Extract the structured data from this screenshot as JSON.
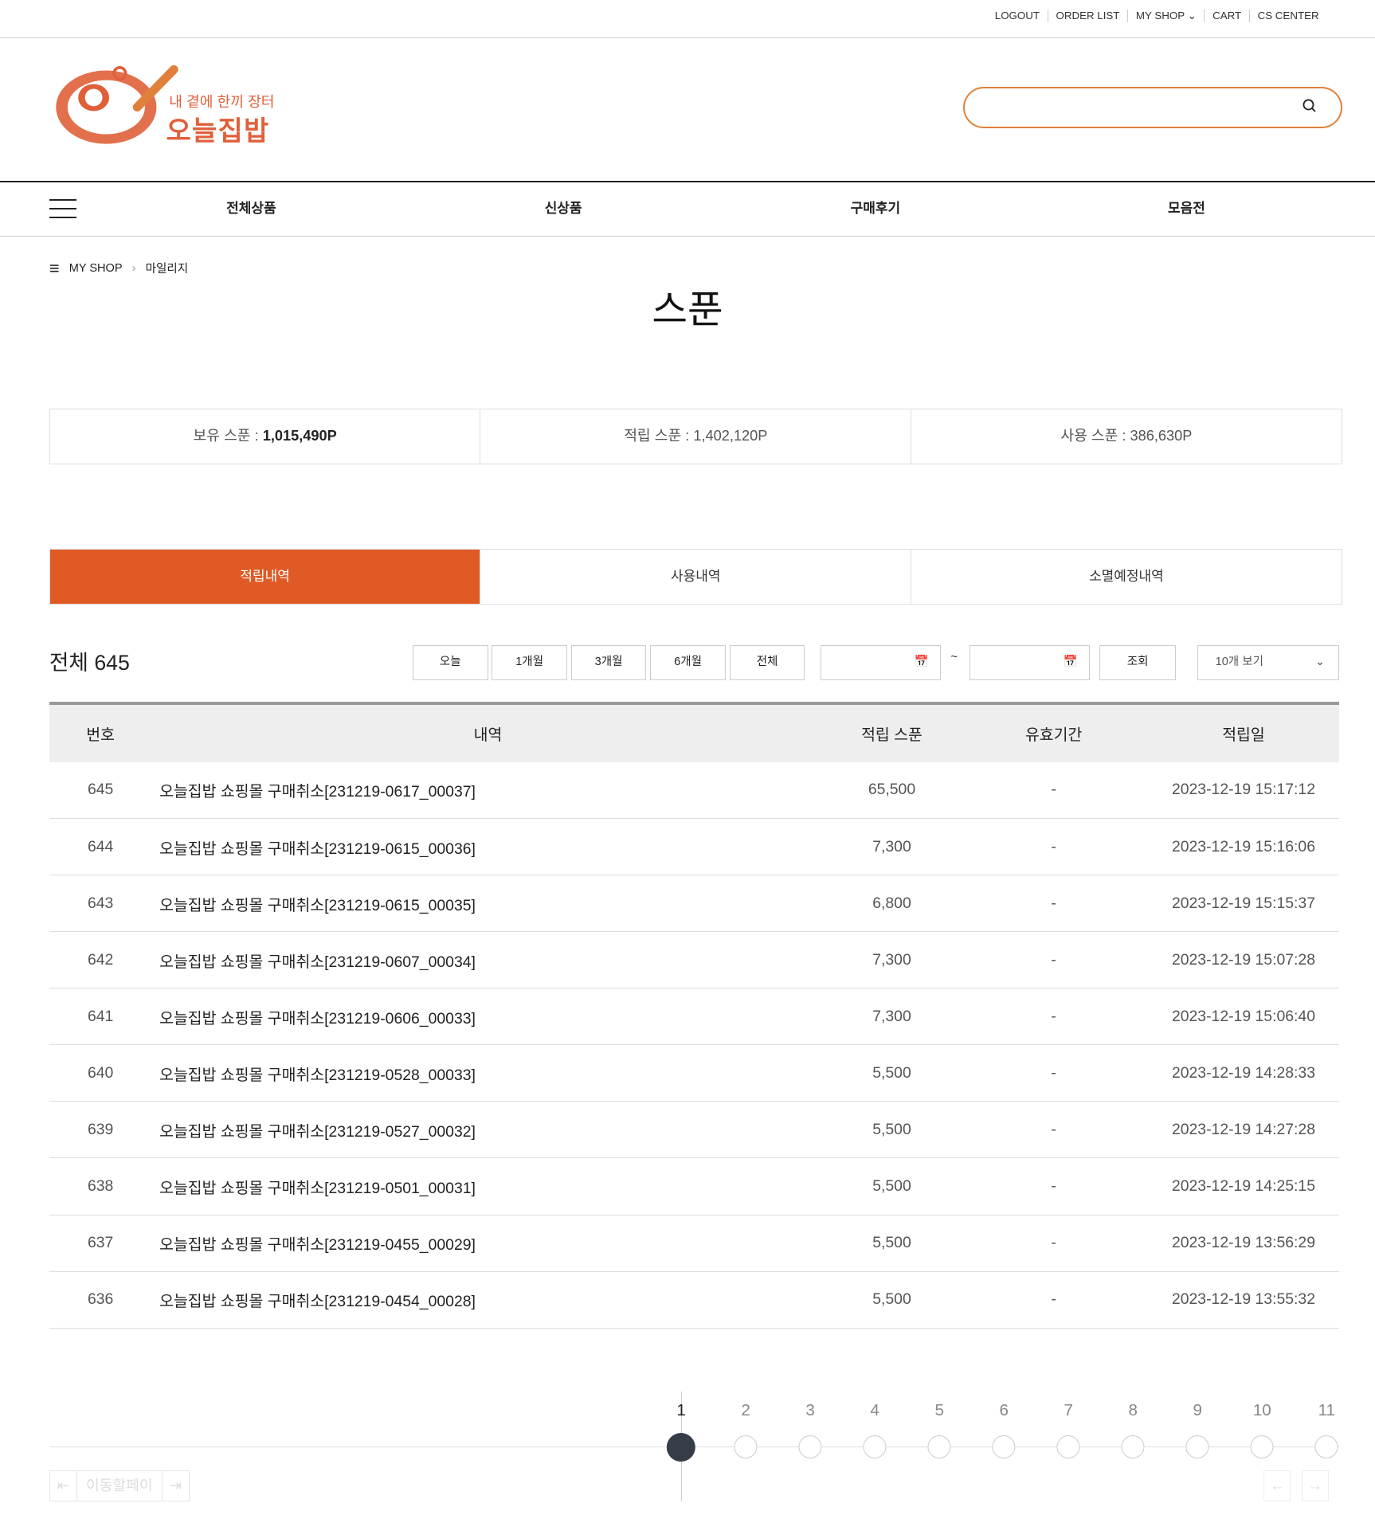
{
  "top_links": [
    "LOGOUT",
    "ORDER LIST",
    "MY SHOP",
    "CART",
    "CS CENTER"
  ],
  "logo": {
    "tagline": "내 곁에 한끼 장터",
    "name": "오늘집밥"
  },
  "search": {
    "value": ""
  },
  "nav": [
    "전체상품",
    "신상품",
    "구매후기",
    "모음전"
  ],
  "breadcrumb": {
    "root": "MY SHOP",
    "current": "마일리지"
  },
  "page_title": "스푼",
  "summary": {
    "hold_label": "보유 스푼 : ",
    "hold": "1,015,490P",
    "earn": "적립 스푼 : 1,402,120P",
    "used": "사용 스푼 : 386,630P"
  },
  "tabs": [
    "적립내역",
    "사용내역",
    "소멸예정내역"
  ],
  "total": "전체 645",
  "filters": [
    "오늘",
    "1개월",
    "3개월",
    "6개월",
    "전체"
  ],
  "date_sep": "~",
  "search_button": "조회",
  "page_size": "10개 보기",
  "columns": [
    "번호",
    "내역",
    "적립 스푼",
    "유효기간",
    "적립일"
  ],
  "rows": [
    [
      "645",
      "오늘집밥 쇼핑몰 구매취소[231219-0617_00037]",
      "65,500",
      "-",
      "2023-12-19 15:17:12"
    ],
    [
      "644",
      "오늘집밥 쇼핑몰 구매취소[231219-0615_00036]",
      "7,300",
      "-",
      "2023-12-19 15:16:06"
    ],
    [
      "643",
      "오늘집밥 쇼핑몰 구매취소[231219-0615_00035]",
      "6,800",
      "-",
      "2023-12-19 15:15:37"
    ],
    [
      "642",
      "오늘집밥 쇼핑몰 구매취소[231219-0607_00034]",
      "7,300",
      "-",
      "2023-12-19 15:07:28"
    ],
    [
      "641",
      "오늘집밥 쇼핑몰 구매취소[231219-0606_00033]",
      "7,300",
      "-",
      "2023-12-19 15:06:40"
    ],
    [
      "640",
      "오늘집밥 쇼핑몰 구매취소[231219-0528_00033]",
      "5,500",
      "-",
      "2023-12-19 14:28:33"
    ],
    [
      "639",
      "오늘집밥 쇼핑몰 구매취소[231219-0527_00032]",
      "5,500",
      "-",
      "2023-12-19 14:27:28"
    ],
    [
      "638",
      "오늘집밥 쇼핑몰 구매취소[231219-0501_00031]",
      "5,500",
      "-",
      "2023-12-19 14:25:15"
    ],
    [
      "637",
      "오늘집밥 쇼핑몰 구매취소[231219-0455_00029]",
      "5,500",
      "-",
      "2023-12-19 13:56:29"
    ],
    [
      "636",
      "오늘집밥 쇼핑몰 구매취소[231219-0454_00028]",
      "5,500",
      "-",
      "2023-12-19 13:55:32"
    ]
  ],
  "pages": [
    "1",
    "2",
    "3",
    "4",
    "5",
    "6",
    "7",
    "8",
    "9",
    "10",
    "11"
  ],
  "current_page": "1",
  "page_jump": "이동할페이",
  "colors": {
    "accent": "#e05a25",
    "active_dot": "#353d49"
  }
}
